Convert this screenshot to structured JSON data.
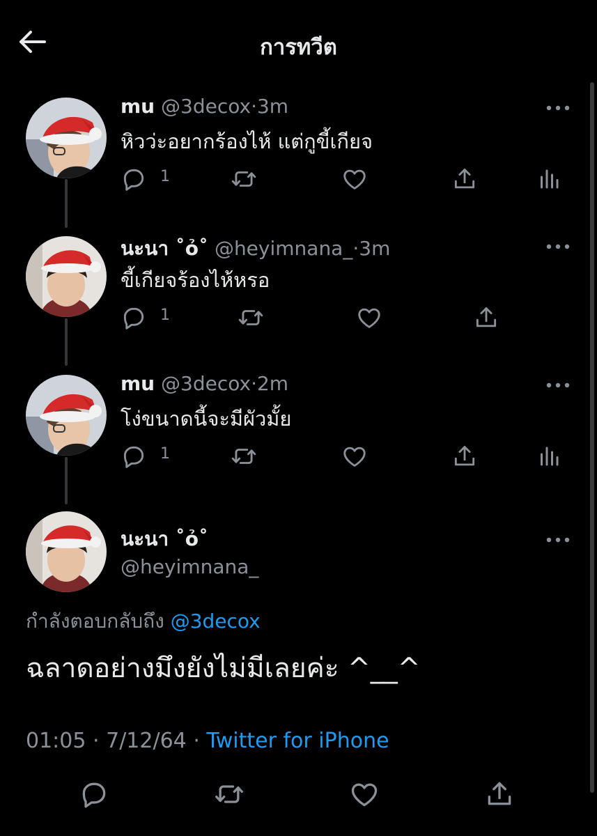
{
  "header": {
    "title": "การทวีต",
    "back_icon": "arrow-left-icon"
  },
  "tweets": [
    {
      "name": "mu",
      "handle": "@3decox",
      "dot": "·",
      "time": "3m",
      "text": "หิวว่ะอยากร้องไห้ แต่กูขี้เกียจ",
      "reply_count": "1",
      "show_stats": true
    },
    {
      "name": "นะนา ˚ỏ˚",
      "handle": "@heyimnana_",
      "dot": "·",
      "time": "3m",
      "text": "ขี้เกียจร้องไห้หรอ",
      "reply_count": "1",
      "show_stats": false
    },
    {
      "name": "mu",
      "handle": "@3decox",
      "dot": "·",
      "time": "2m",
      "text": "โง่ขนาดนี้จะมีผัวมั้ย",
      "reply_count": "1",
      "show_stats": true
    }
  ],
  "main_tweet": {
    "name": "นะนา ˚ỏ˚",
    "handle": "@heyimnana_",
    "reply_prefix": "กำลังตอบกลับถึง",
    "reply_mention": "@3decox",
    "text": "ฉลาดอย่างมึงยังไม่มีเลยค่ะ ^__^",
    "time": "01:05",
    "separator": "·",
    "date": "7/12/64",
    "source": "Twitter for iPhone"
  },
  "colors": {
    "background": "#000000",
    "text": "#e7e9ea",
    "muted": "#8b9199",
    "accent": "#1d9bf0"
  }
}
